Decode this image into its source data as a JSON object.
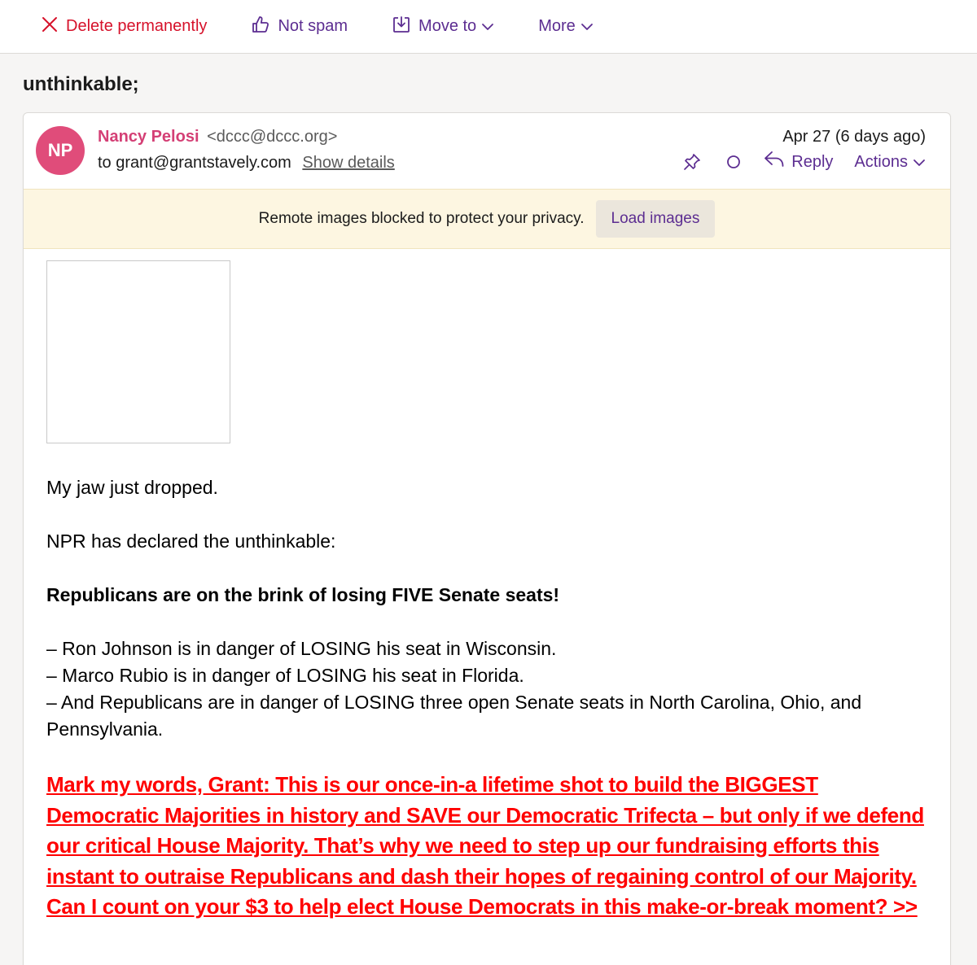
{
  "toolbar": {
    "delete_label": "Delete permanently",
    "not_spam_label": "Not spam",
    "move_to_label": "Move to",
    "more_label": "More"
  },
  "subject": "unthinkable;",
  "message": {
    "avatar_initials": "NP",
    "sender_name": "Nancy Pelosi",
    "sender_email": "<dccc@dccc.org>",
    "to": "to grant@grantstavely.com",
    "show_details_label": "Show details",
    "date": "Apr 27 (6 days ago)",
    "reply_label": "Reply",
    "actions_label": "Actions"
  },
  "banner": {
    "text": "Remote images blocked to protect your privacy.",
    "load_images_label": "Load images"
  },
  "body": {
    "p1": "My jaw just dropped.",
    "p2": "NPR has declared the unthinkable:",
    "p3": "Republicans are on the brink of losing FIVE Senate seats!",
    "list": [
      "– Ron Johnson is in danger of LOSING his seat in Wisconsin.",
      "– Marco Rubio is in danger of LOSING his seat in Florida.",
      "– And Republicans are in danger of LOSING three open Senate seats in North Carolina, Ohio, and Pennsylvania."
    ],
    "cta": "Mark my words, Grant: This is our once-in-a lifetime shot to build the BIGGEST Democratic Majorities in history and SAVE our Democratic Trifecta – but only if we defend our critical House Majority. That’s why we need to step up our fundraising efforts this instant to outraise Republicans and dash their hopes of regaining control of our Majority. Can I count on your $3 to help elect House Democrats in this make-or-break moment? >>"
  },
  "colors": {
    "accent": "#5c2d91",
    "danger": "#d6112a",
    "sender": "#d43f75",
    "avatar_bg": "#e04c7a",
    "banner_bg": "#fdf6e1",
    "cta": "#ff0000"
  }
}
